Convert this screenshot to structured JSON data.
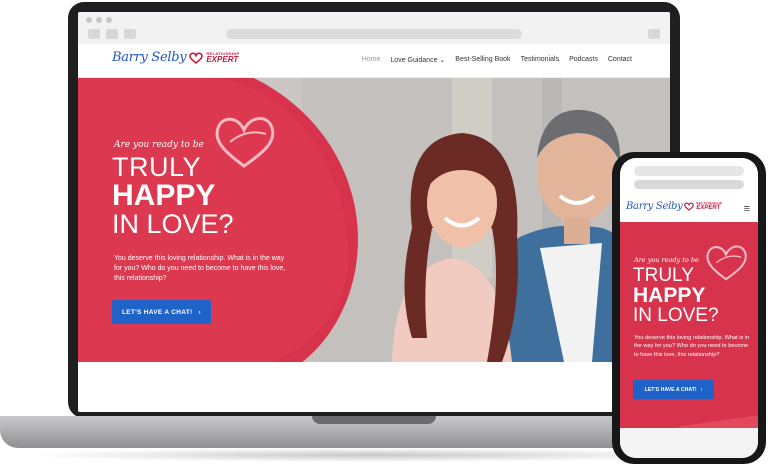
{
  "site": {
    "logo": {
      "script": "Barry Selby",
      "tag_top": "RELATIONSHIP",
      "tag_bottom": "EXPERT"
    },
    "nav": [
      {
        "label": "Home",
        "active": true
      },
      {
        "label": "Love Guidance",
        "dropdown": true
      },
      {
        "label": "Best-Selling Book"
      },
      {
        "label": "Testimonials"
      },
      {
        "label": "Podcasts"
      },
      {
        "label": "Contact"
      }
    ],
    "nav_dropdown_glyph": "⌄",
    "hero": {
      "question": "Are you ready to be",
      "headline_1": "TRULY",
      "headline_2": "HAPPY",
      "headline_3": "IN LOVE?",
      "body": "You deserve this loving relationship. What is in the way for you? Who do you need to become to have this love, this relationship?",
      "cta": "LET'S HAVE A CHAT!",
      "cta_arrow": "›"
    }
  },
  "phone": {
    "menu_icon": "≡"
  },
  "colors": {
    "hero_red": "#d8334c",
    "cta_blue": "#1f63c9",
    "logo_blue": "#1e56c8",
    "logo_red": "#c4193d"
  },
  "icons": [
    "heart-icon",
    "menu-icon",
    "chevron-down-icon",
    "arrow-right-icon"
  ]
}
